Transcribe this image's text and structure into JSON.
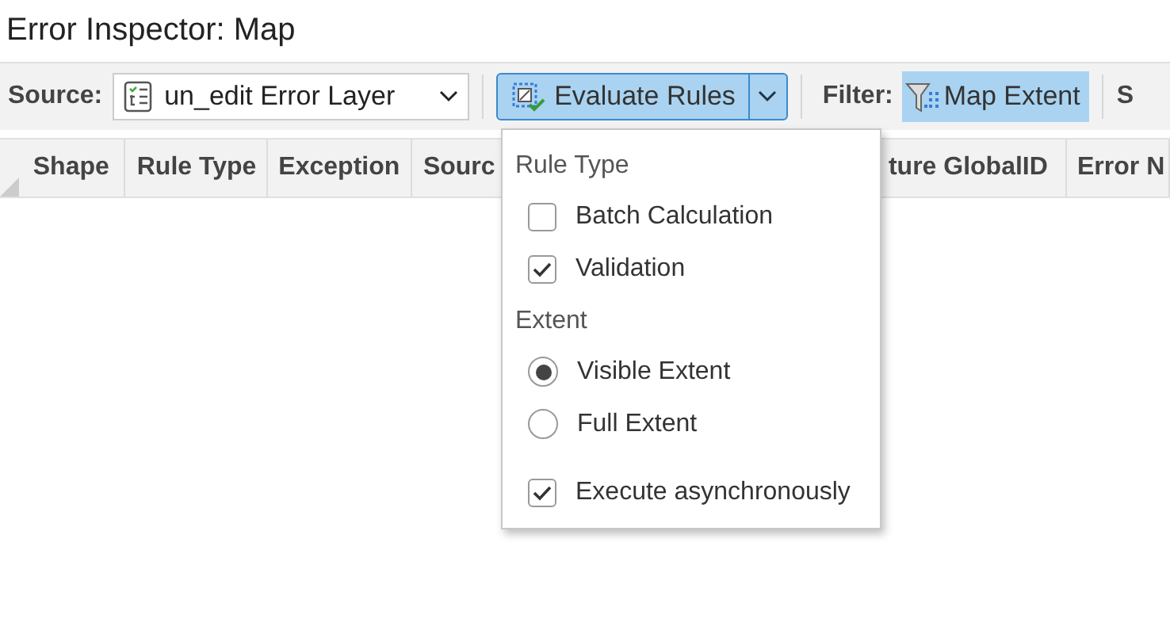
{
  "window": {
    "title": "Error Inspector: Map"
  },
  "toolbar": {
    "source_label": "Source:",
    "source_value": "un_edit Error Layer",
    "evaluate_button": "Evaluate Rules",
    "filter_label": "Filter:",
    "filter_button": {
      "label": "Map Extent",
      "on": true
    },
    "cut_label": "S"
  },
  "table": {
    "columns": [
      {
        "label": "Shape"
      },
      {
        "label": "Rule Type"
      },
      {
        "label": "Exception"
      },
      {
        "label": "Sourc"
      },
      {
        "label": "ture GlobalID"
      },
      {
        "label": "Error N"
      }
    ]
  },
  "menu": {
    "items": [
      {
        "kind": "heading",
        "label": "Rule Type"
      },
      {
        "kind": "checkbox",
        "label": "Batch Calculation",
        "checked": false
      },
      {
        "kind": "checkbox",
        "label": "Validation",
        "checked": true
      },
      {
        "kind": "heading",
        "label": "Extent"
      },
      {
        "kind": "radio",
        "label": "Visible Extent",
        "selected": true
      },
      {
        "kind": "radio",
        "label": "Full Extent",
        "selected": false
      },
      {
        "kind": "separator"
      },
      {
        "kind": "checkbox",
        "label": "Execute asynchronously",
        "checked": true
      }
    ]
  }
}
